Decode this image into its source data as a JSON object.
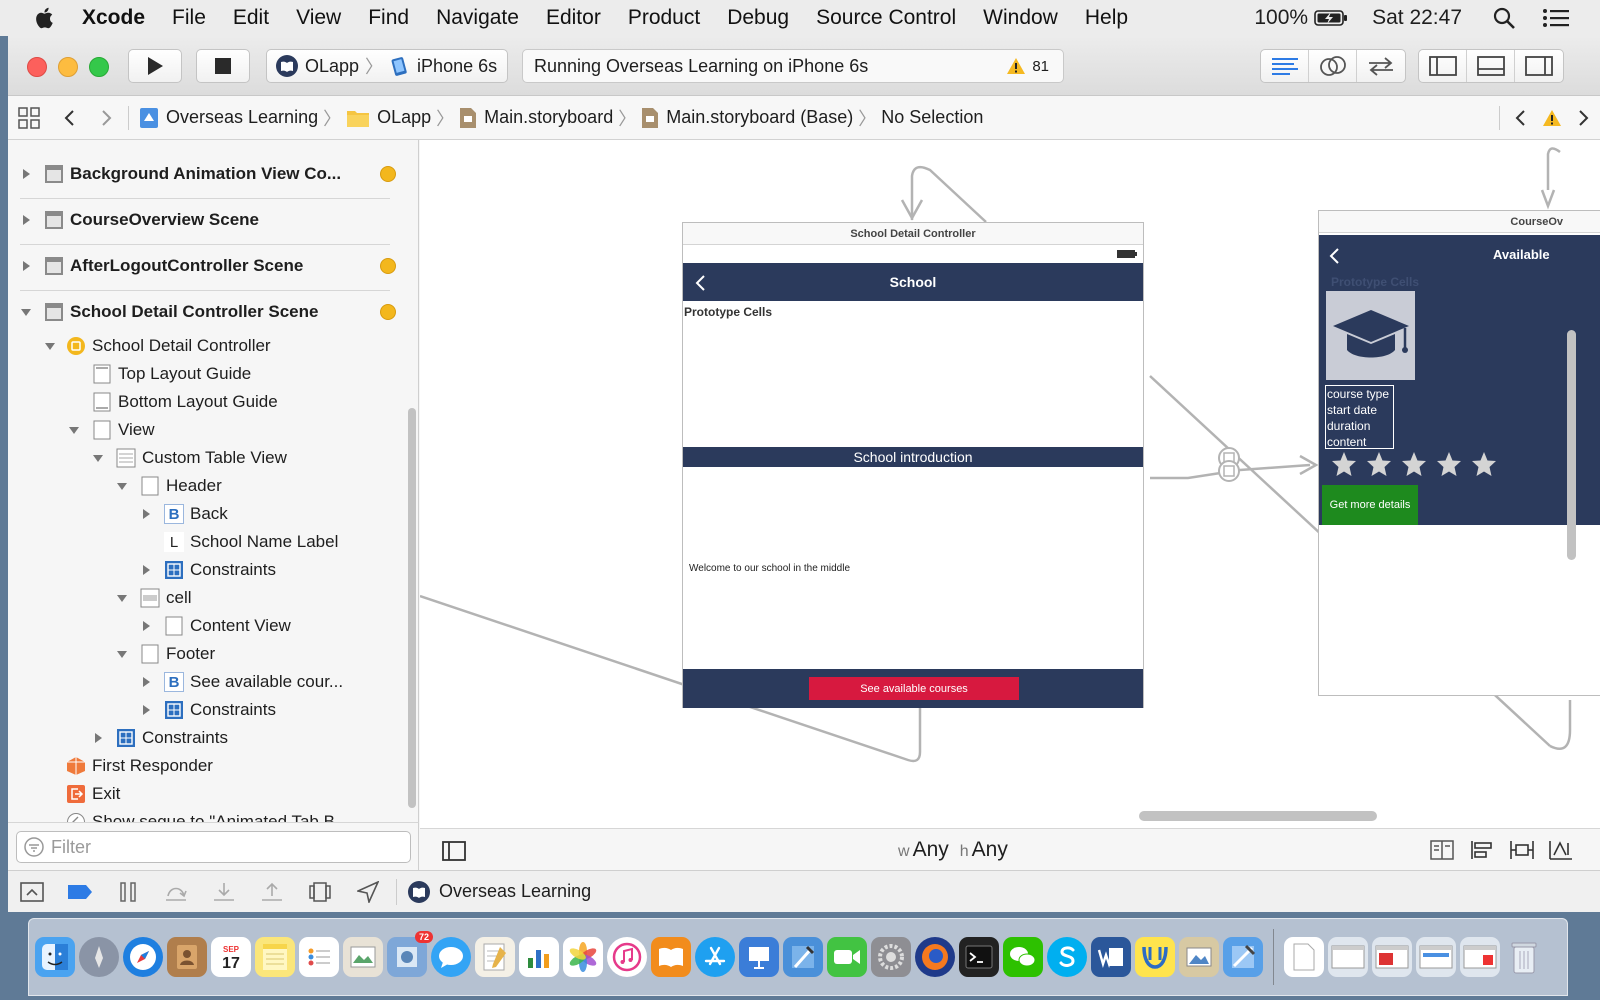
{
  "menubar": {
    "app_name": "Xcode",
    "items": [
      "File",
      "Edit",
      "View",
      "Find",
      "Navigate",
      "Editor",
      "Product",
      "Debug",
      "Source Control",
      "Window",
      "Help"
    ],
    "battery": "100%",
    "clock": "Sat 22:47"
  },
  "toolbar": {
    "scheme_target": "OLapp",
    "scheme_device": "iPhone 6s",
    "activity_text": "Running Overseas Learning on iPhone 6s",
    "warning_count": "81"
  },
  "jumpbar": {
    "crumbs": [
      "Overseas Learning",
      "OLapp",
      "Main.storyboard",
      "Main.storyboard (Base)",
      "No Selection"
    ]
  },
  "outline": {
    "scenes": [
      {
        "label": "Background Animation View Co...",
        "badge": true
      },
      {
        "label": "CourseOverview Scene",
        "badge": false
      },
      {
        "label": "AfterLogoutController Scene",
        "badge": true
      },
      {
        "label": "School Detail Controller Scene",
        "badge": true
      }
    ],
    "tree": [
      {
        "label": "School Detail Controller"
      },
      {
        "label": "Top Layout Guide"
      },
      {
        "label": "Bottom Layout Guide"
      },
      {
        "label": "View"
      },
      {
        "label": "Custom Table View"
      },
      {
        "label": "Header"
      },
      {
        "label": "Back",
        "glyph": "B"
      },
      {
        "label": "School Name Label",
        "glyph": "L"
      },
      {
        "label": "Constraints"
      },
      {
        "label": "cell"
      },
      {
        "label": "Content View"
      },
      {
        "label": "Footer"
      },
      {
        "label": "See available cour...",
        "glyph": "B"
      },
      {
        "label": "Constraints"
      },
      {
        "label": "Constraints"
      },
      {
        "label": "First Responder"
      },
      {
        "label": "Exit"
      },
      {
        "label": "Show segue to \"Animated Tab B..."
      }
    ]
  },
  "filter": {
    "placeholder": "Filter"
  },
  "canvas": {
    "school_scene": {
      "frame_title": "School Detail Controller",
      "nav_title": "School",
      "prototype_label": "Prototype Cells",
      "section_title": "School introduction",
      "body_text": "Welcome to our school in the middle",
      "footer_button": "See available courses"
    },
    "course_scene": {
      "frame_title": "CourseOv",
      "nav_title": "Available",
      "prototype_label": "Prototype Cells",
      "lines": [
        "course type",
        "start date",
        "duration",
        "content"
      ],
      "details_button": "Get more details",
      "rating_stars": 5
    },
    "size_class": {
      "w_prefix": "w",
      "w": "Any",
      "h_prefix": "h",
      "h": "Any"
    }
  },
  "debugbar": {
    "target": "Overseas Learning"
  },
  "dock": {
    "calendar_day": "17",
    "calendar_month": "SEP",
    "badge": "72"
  },
  "colors": {
    "nav_blue": "#2b3a5c",
    "footer_red": "#d7193f",
    "details_green": "#1e8a1e",
    "scene_badge": "#f3b71d"
  }
}
